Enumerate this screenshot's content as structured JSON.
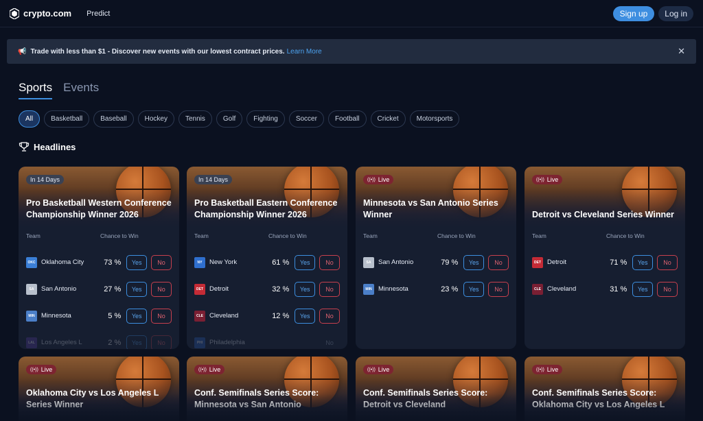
{
  "header": {
    "brand": "crypto.com",
    "nav_predict": "Predict",
    "signup_label": "Sign up",
    "login_label": "Log in"
  },
  "banner": {
    "text": "Trade with less than $1 - Discover new events with our lowest contract prices.",
    "link": "Learn More",
    "close": "✕"
  },
  "tabs": [
    {
      "label": "Sports",
      "active": true
    },
    {
      "label": "Events",
      "active": false
    }
  ],
  "chips": [
    "All",
    "Basketball",
    "Baseball",
    "Hockey",
    "Tennis",
    "Golf",
    "Fighting",
    "Soccer",
    "Football",
    "Cricket",
    "Motorsports"
  ],
  "headlines": "Headlines",
  "table_headers": {
    "team": "Team",
    "chance": "Chance to Win"
  },
  "buttons": {
    "yes": "Yes",
    "no": "No"
  },
  "colors": {
    "accent": "#3d8fe0",
    "live": "#7d2431",
    "no": "#c8404e"
  },
  "cards": [
    {
      "badge": "In 14 Days",
      "badge_type": "days",
      "title": "Pro Basketball Western Conference Championship Winner 2026",
      "rows": [
        {
          "abbr": "OKC",
          "color": "#3b7fd6",
          "team": "Oklahoma City",
          "pct": "73 %"
        },
        {
          "abbr": "SA",
          "color": "#b8c0cc",
          "team": "San Antonio",
          "pct": "27 %"
        },
        {
          "abbr": "MIN",
          "color": "#4b7fc8",
          "team": "Minnesota",
          "pct": "5 %"
        },
        {
          "abbr": "LAL",
          "color": "#5a3ea0",
          "team": "Los Angeles L",
          "pct": "2 %"
        }
      ]
    },
    {
      "badge": "In 14 Days",
      "badge_type": "days",
      "title": "Pro Basketball Eastern Conference Championship Winner 2026",
      "rows": [
        {
          "abbr": "NY",
          "color": "#2f6fce",
          "team": "New York",
          "pct": "61 %"
        },
        {
          "abbr": "DET",
          "color": "#c42b36",
          "team": "Detroit",
          "pct": "32 %"
        },
        {
          "abbr": "CLE",
          "color": "#7a1f33",
          "team": "Cleveland",
          "pct": "12 %"
        },
        {
          "abbr": "PHI",
          "color": "#2b5fb8",
          "team": "Philadelphia",
          "pct": ""
        }
      ]
    },
    {
      "badge": "Live",
      "badge_type": "live",
      "title": "Minnesota vs San Antonio Series Winner",
      "rows": [
        {
          "abbr": "SA",
          "color": "#b8c0cc",
          "team": "San Antonio",
          "pct": "79 %"
        },
        {
          "abbr": "MIN",
          "color": "#4b7fc8",
          "team": "Minnesota",
          "pct": "23 %"
        }
      ]
    },
    {
      "badge": "Live",
      "badge_type": "live",
      "title": "Detroit vs Cleveland Series Winner",
      "rows": [
        {
          "abbr": "DET",
          "color": "#c42b36",
          "team": "Detroit",
          "pct": "71 %"
        },
        {
          "abbr": "CLE",
          "color": "#7a1f33",
          "team": "Cleveland",
          "pct": "31 %"
        }
      ]
    },
    {
      "badge": "Live",
      "badge_type": "live",
      "title": "Oklahoma City vs Los Angeles L Series Winner",
      "rows": []
    },
    {
      "badge": "Live",
      "badge_type": "live",
      "title": "Conf. Semifinals Series Score: Minnesota vs San Antonio",
      "rows": []
    },
    {
      "badge": "Live",
      "badge_type": "live",
      "title": "Conf. Semifinals Series Score: Detroit vs Cleveland",
      "rows": []
    },
    {
      "badge": "Live",
      "badge_type": "live",
      "title": "Conf. Semifinals Series Score: Oklahoma City vs Los Angeles L",
      "rows": []
    }
  ]
}
